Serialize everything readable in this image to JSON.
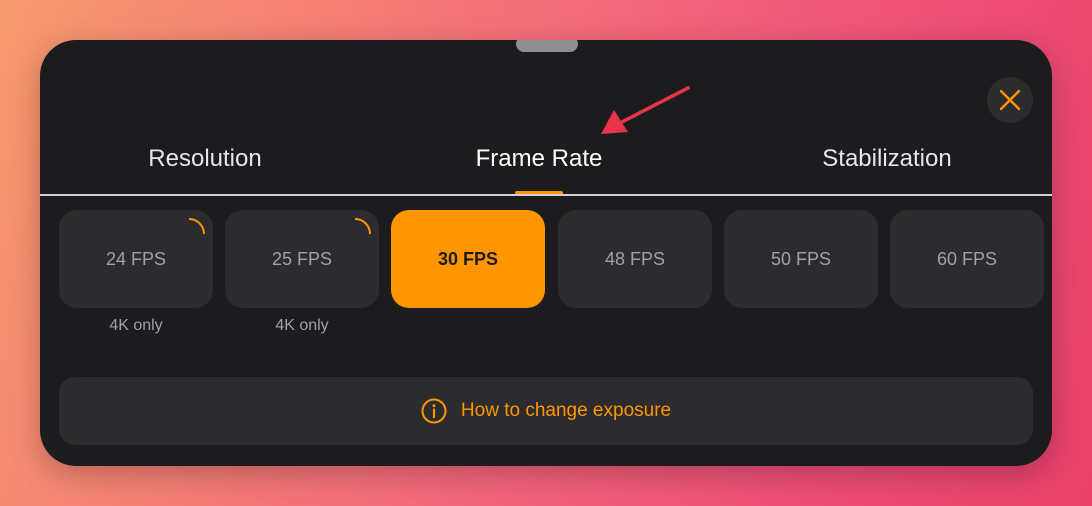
{
  "colors": {
    "accent": "#ff9500",
    "panel": "#1c1c1e",
    "card": "#2c2c2e",
    "annotation_arrow": "#e8354a"
  },
  "close_button": {
    "icon": "close-icon"
  },
  "tabs": [
    {
      "label": "Resolution",
      "active": false
    },
    {
      "label": "Frame Rate",
      "active": true
    },
    {
      "label": "Stabilization",
      "active": false
    }
  ],
  "frame_rates": [
    {
      "label": "24 FPS",
      "note": "4K only",
      "selected": false,
      "marked": true
    },
    {
      "label": "25 FPS",
      "note": "4K only",
      "selected": false,
      "marked": true
    },
    {
      "label": "30 FPS",
      "note": "",
      "selected": true,
      "marked": false
    },
    {
      "label": "48 FPS",
      "note": "",
      "selected": false,
      "marked": false
    },
    {
      "label": "50 FPS",
      "note": "",
      "selected": false,
      "marked": false
    },
    {
      "label": "60 FPS",
      "note": "",
      "selected": false,
      "marked": false
    }
  ],
  "help": {
    "icon": "info-icon",
    "label": "How to change exposure"
  }
}
